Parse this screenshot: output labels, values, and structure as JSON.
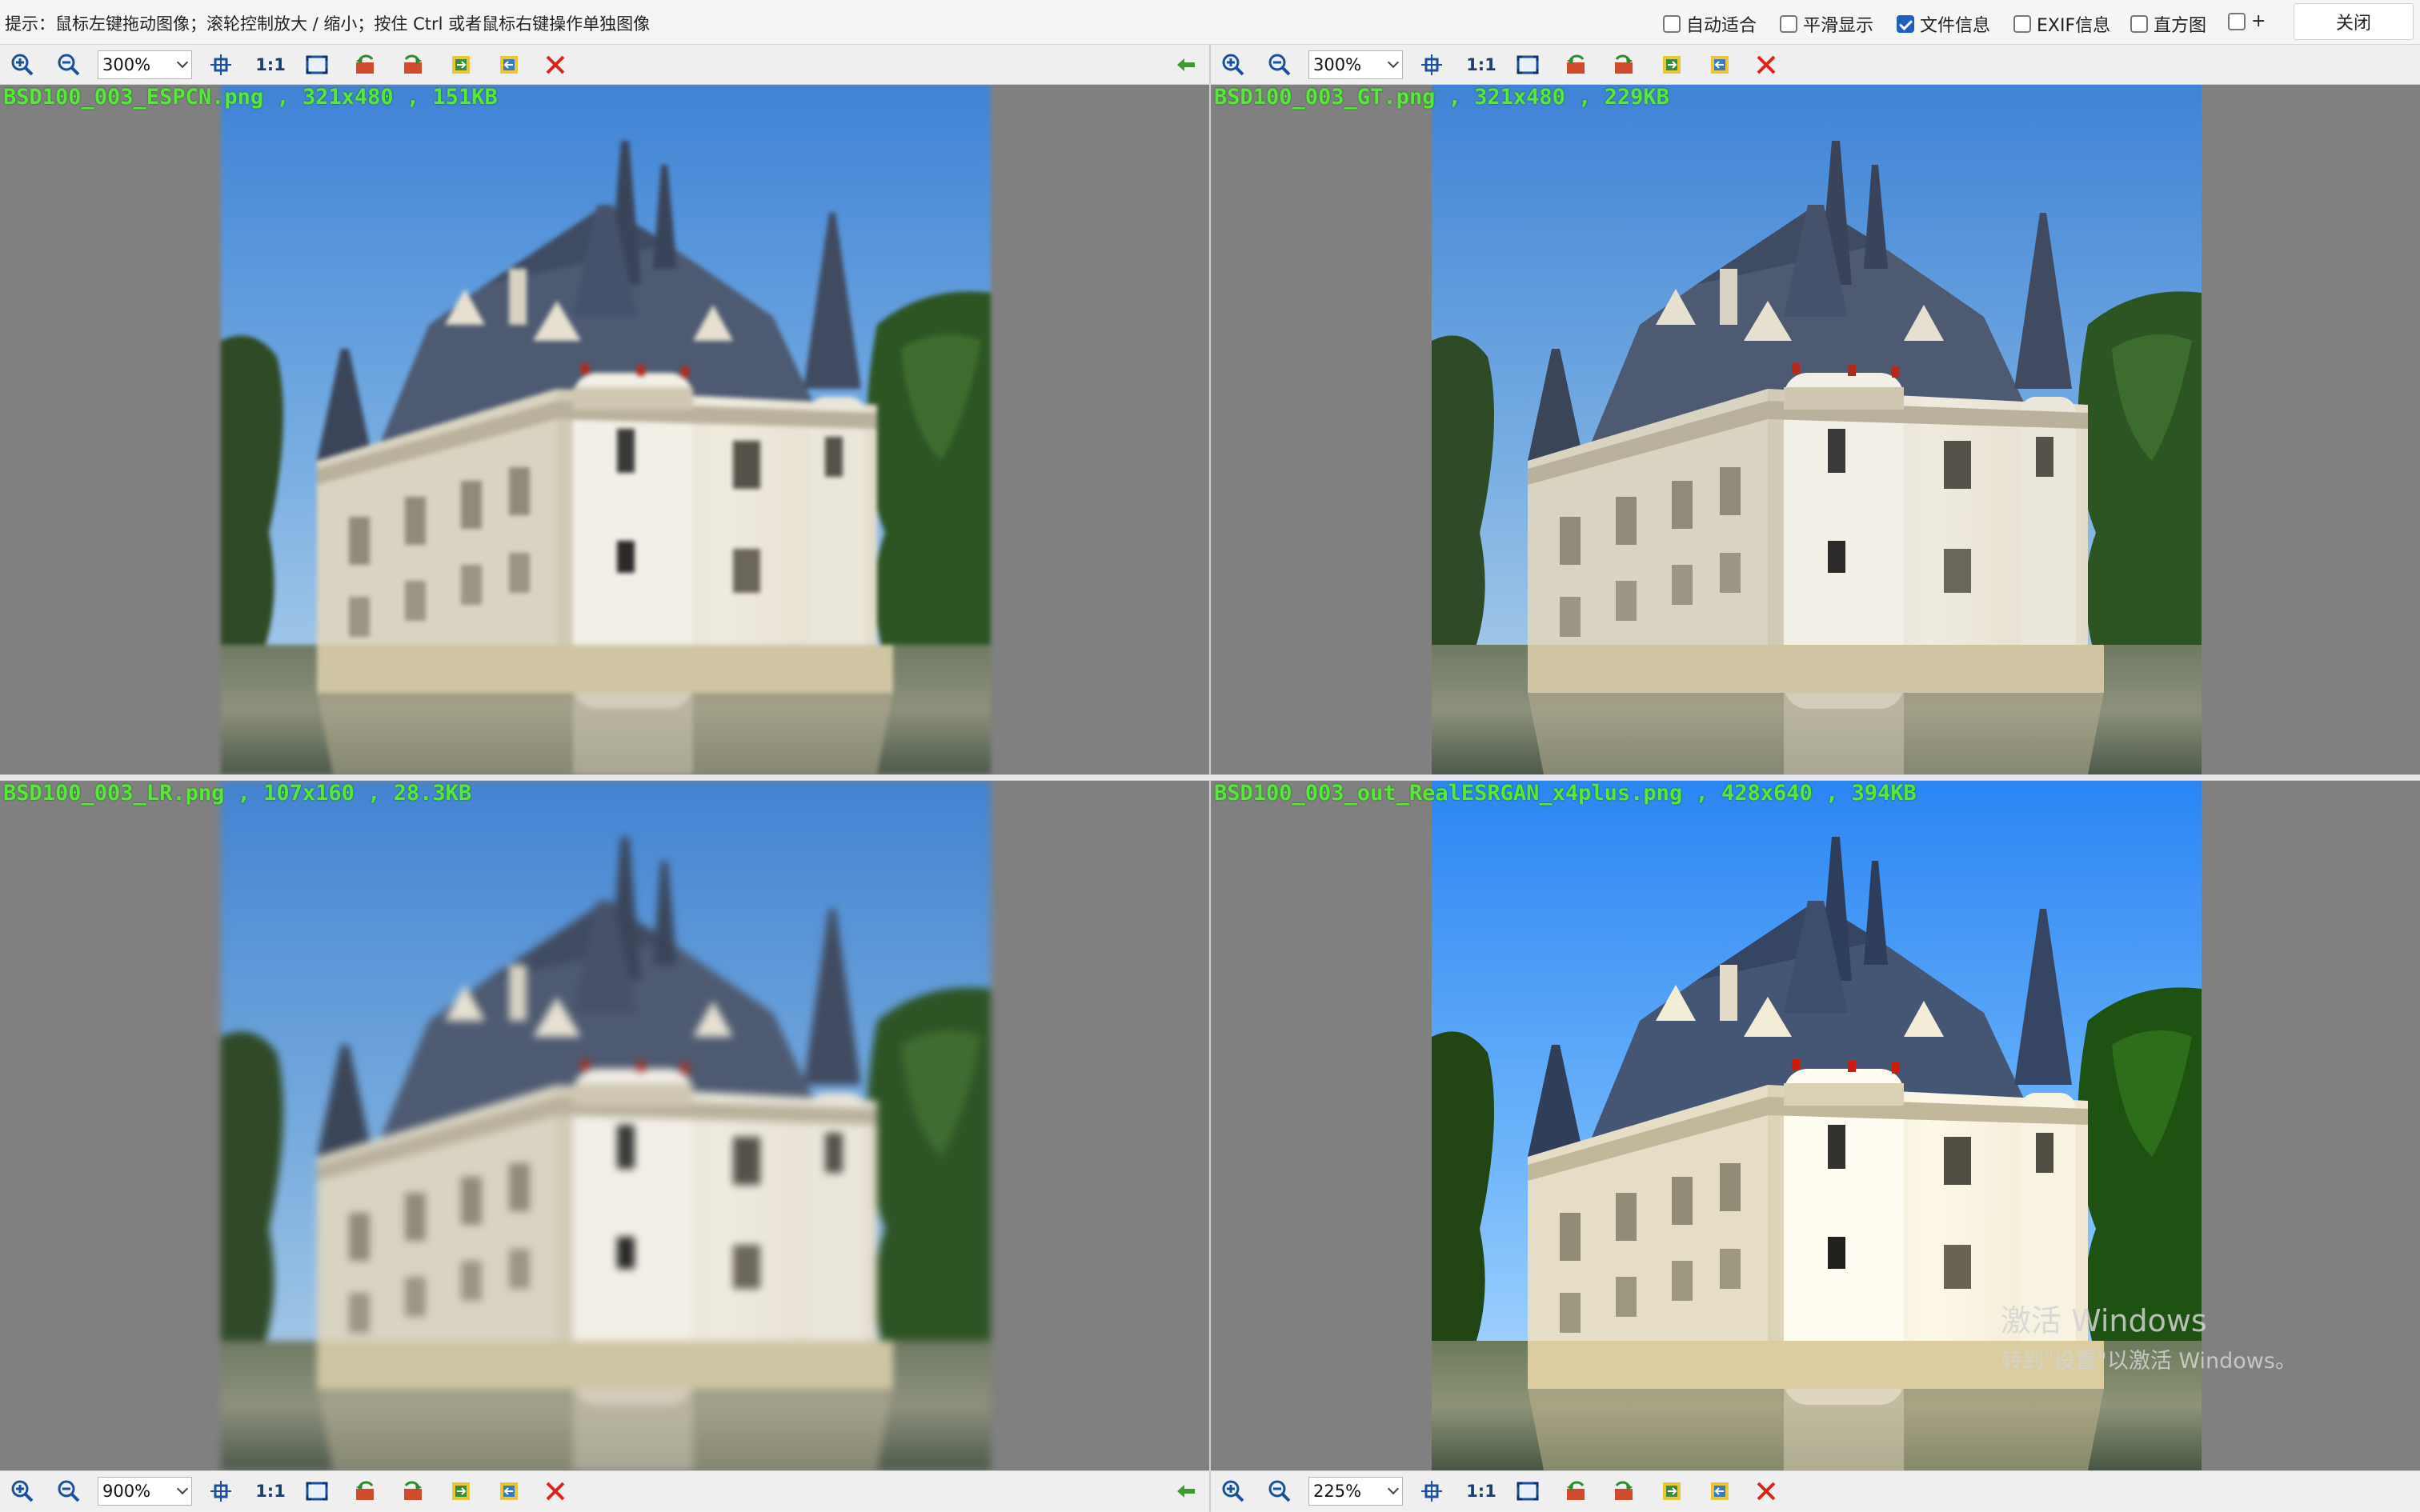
{
  "hint": "提示：鼠标左键拖动图像；滚轮控制放大 / 缩小；按住 Ctrl 或者鼠标右键操作单独图像",
  "options": [
    {
      "label": "自动适合",
      "checked": false
    },
    {
      "label": "平滑显示",
      "checked": false
    },
    {
      "label": "文件信息",
      "checked": true
    },
    {
      "label": "EXIF信息",
      "checked": false
    },
    {
      "label": "直方图",
      "checked": false
    },
    {
      "label": "+",
      "checked": false
    }
  ],
  "close_label": "关闭",
  "one_to_one_label": "1:1",
  "panels": {
    "top_left": {
      "zoom": "300%",
      "file_info": "BSD100_003_ESPCN.png , 321x480 , 151KB"
    },
    "top_right": {
      "zoom": "300%",
      "file_info": "BSD100_003_GT.png , 321x480 , 229KB"
    },
    "bottom_left": {
      "zoom": "900%",
      "file_info": "BSD100_003_LR.png , 107x160 , 28.3KB"
    },
    "bottom_right": {
      "zoom": "225%",
      "file_info": "BSD100_003_out_RealESRGAN_x4plus.png , 428x640 , 394KB"
    }
  },
  "watermark": {
    "line1": "激活 Windows",
    "line2": "转到\"设置\"以激活 Windows。"
  },
  "colors": {
    "file_info_text": "#57e83b",
    "panel_background": "#808080",
    "checked": "#1f5fbf",
    "close_x": "#d8261c"
  }
}
